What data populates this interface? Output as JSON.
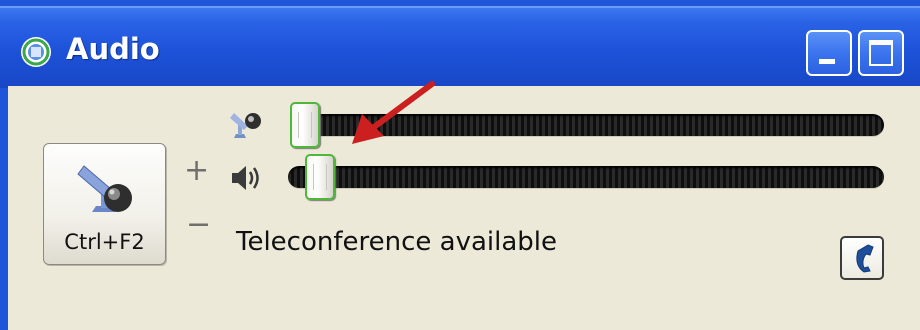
{
  "window": {
    "title": "Audio",
    "icons": {
      "app": "app-icon",
      "minimize": "minimize-icon",
      "maximize": "maximize-icon"
    }
  },
  "call_button": {
    "shortcut": "Ctrl+F2",
    "icon": "microphone-icon"
  },
  "volume": {
    "increase_symbol": "+",
    "decrease_symbol": "−",
    "microphone_level": 0.0,
    "speaker_level": 0.03
  },
  "status": {
    "text": "Teleconference available"
  },
  "phone_button": {
    "icon": "phone-handset-icon"
  },
  "colors": {
    "titlebar": "#1f55d8",
    "client_bg": "#ece9d8",
    "thumb_border": "#4fb83a",
    "annotation_arrow": "#cc1f1f"
  }
}
